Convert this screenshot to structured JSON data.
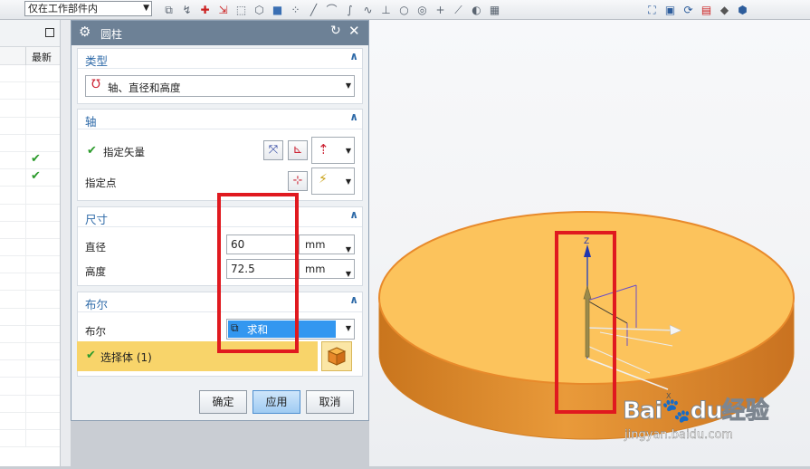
{
  "toolbar": {
    "filter_value": "仅在工作部件内",
    "icons": [
      "snap-icon",
      "select-icon",
      "point-icon",
      "move-icon",
      "box-select-icon",
      "view-icon",
      "cube-icon",
      "snap-point-icon",
      "line-icon",
      "arc-icon",
      "curve-icon",
      "spline-icon",
      "intersect-icon",
      "circle-icon",
      "center-icon",
      "plus-icon",
      "tangent-icon",
      "face-icon",
      "grid-icon"
    ],
    "right_icons": [
      "fit-icon",
      "render-icon",
      "refresh-icon",
      "layout-icon",
      "shade-icon",
      "display-icon"
    ]
  },
  "navigator": {
    "column_latest": "最新",
    "checked_rows": [
      5,
      6
    ]
  },
  "dialog": {
    "title": "圆柱",
    "type_section": {
      "label": "类型",
      "value": "轴、直径和高度"
    },
    "axis_section": {
      "label": "轴",
      "vector_label": "指定矢量",
      "point_label": "指定点"
    },
    "dimension_section": {
      "label": "尺寸",
      "diameter_label": "直径",
      "diameter_value": "60",
      "diameter_unit": "mm",
      "height_label": "高度",
      "height_value": "72.5",
      "height_unit": "mm"
    },
    "boolean_section": {
      "label": "布尔",
      "boolean_label": "布尔",
      "boolean_value": "求和",
      "select_body": "选择体 (1)"
    },
    "buttons": {
      "ok": "确定",
      "apply": "应用",
      "cancel": "取消"
    }
  },
  "viewport": {
    "axis_label": "Z",
    "colors": {
      "cylinder_top": "#fcc35c",
      "cylinder_side": "#e28d2a",
      "highlight": "#e0191f"
    }
  },
  "watermark": {
    "brand": "Bai",
    "brand2": "du",
    "brand_cn": "经验",
    "url": "jingyan.baidu.com"
  }
}
